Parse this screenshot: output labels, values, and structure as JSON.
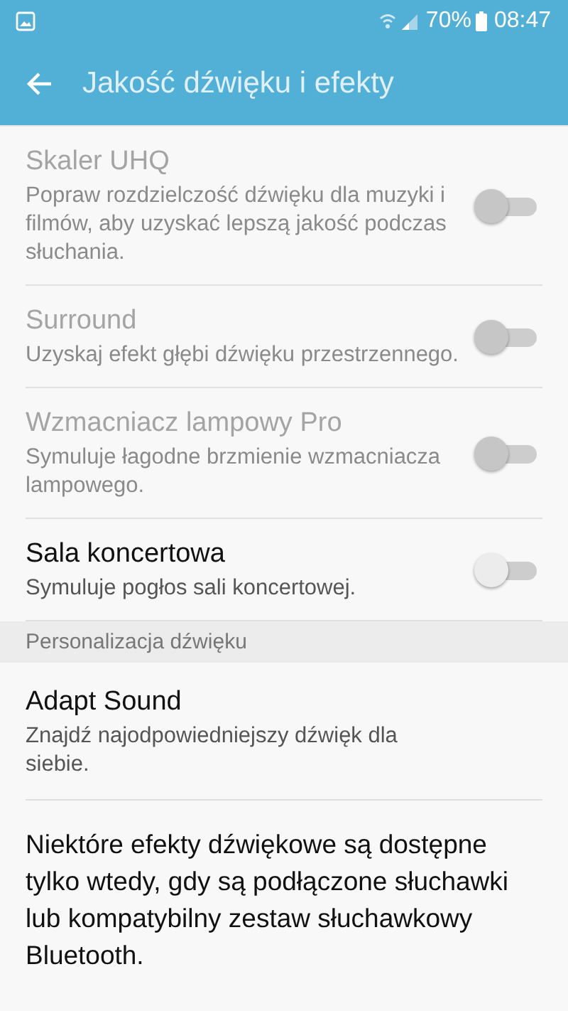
{
  "status_bar": {
    "battery": "70%",
    "time": "08:47"
  },
  "header": {
    "title": "Jakość dźwięku i efekty"
  },
  "sections": [
    {
      "items": [
        {
          "kind": "toggle",
          "title": "Skaler UHQ",
          "summary": "Popraw rozdzielczość dźwięku dla muzyki i filmów, aby uzyskać lepszą jakość podczas słuchania.",
          "disabled": true,
          "on": false
        },
        {
          "kind": "toggle",
          "title": "Surround",
          "summary": "Uzyskaj efekt głębi dźwięku przestrzennego.",
          "disabled": true,
          "on": false
        },
        {
          "kind": "toggle",
          "title": "Wzmacniacz lampowy Pro",
          "summary": "Symuluje łagodne brzmienie wzmacniacza lampowego.",
          "disabled": true,
          "on": false
        },
        {
          "kind": "toggle",
          "title": "Sala koncertowa",
          "summary": "Symuluje pogłos sali koncertowej.",
          "disabled": false,
          "on": false
        }
      ]
    },
    {
      "header": "Personalizacja dźwięku",
      "items": [
        {
          "kind": "link",
          "title": "Adapt Sound",
          "summary": "Znajdź najodpowiedniejszy dźwięk dla siebie.",
          "disabled": false
        }
      ]
    }
  ],
  "note": "Niektóre efekty dźwiękowe są dostępne tylko wtedy, gdy są podłączone słuchawki lub kompatybilny zestaw słuchawkowy Bluetooth."
}
